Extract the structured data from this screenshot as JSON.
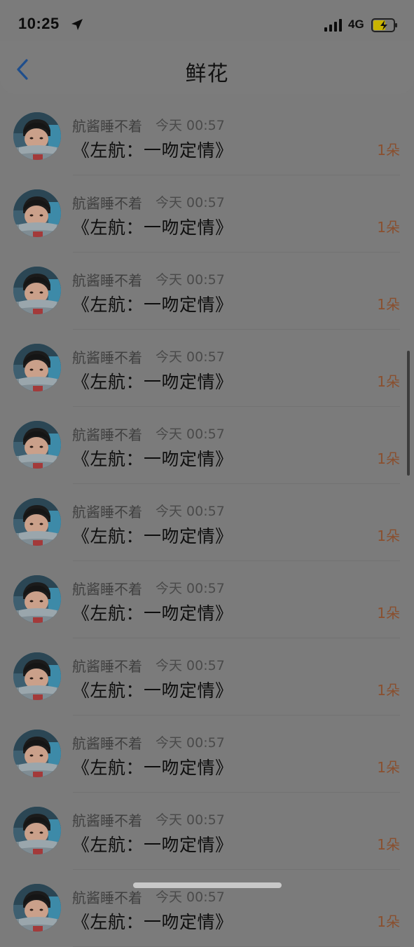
{
  "status_bar": {
    "time": "10:25",
    "network": "4G",
    "icons": [
      "location-arrow-icon",
      "signal-bars-icon",
      "battery-charging-icon"
    ]
  },
  "nav": {
    "title": "鲜花",
    "back_icon": "chevron-left-icon"
  },
  "colors": {
    "count": "#8a4f2e",
    "back": "#1f4e8c"
  },
  "items": [
    {
      "name": "航酱睡不着",
      "time": "今天 00:57",
      "title": "《左航：一吻定情》",
      "count": "1朵"
    },
    {
      "name": "航酱睡不着",
      "time": "今天 00:57",
      "title": "《左航：一吻定情》",
      "count": "1朵"
    },
    {
      "name": "航酱睡不着",
      "time": "今天 00:57",
      "title": "《左航：一吻定情》",
      "count": "1朵"
    },
    {
      "name": "航酱睡不着",
      "time": "今天 00:57",
      "title": "《左航：一吻定情》",
      "count": "1朵"
    },
    {
      "name": "航酱睡不着",
      "time": "今天 00:57",
      "title": "《左航：一吻定情》",
      "count": "1朵"
    },
    {
      "name": "航酱睡不着",
      "time": "今天 00:57",
      "title": "《左航：一吻定情》",
      "count": "1朵"
    },
    {
      "name": "航酱睡不着",
      "time": "今天 00:57",
      "title": "《左航：一吻定情》",
      "count": "1朵"
    },
    {
      "name": "航酱睡不着",
      "time": "今天 00:57",
      "title": "《左航：一吻定情》",
      "count": "1朵"
    },
    {
      "name": "航酱睡不着",
      "time": "今天 00:57",
      "title": "《左航：一吻定情》",
      "count": "1朵"
    },
    {
      "name": "航酱睡不着",
      "time": "今天 00:57",
      "title": "《左航：一吻定情》",
      "count": "1朵"
    },
    {
      "name": "航酱睡不着",
      "time": "今天 00:57",
      "title": "《左航：一吻定情》",
      "count": "1朵"
    }
  ]
}
